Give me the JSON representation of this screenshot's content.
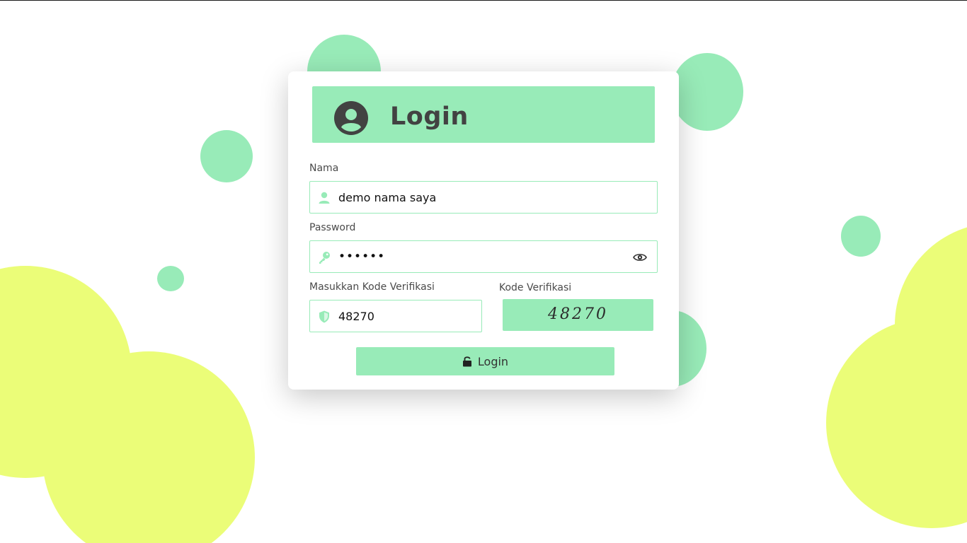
{
  "colors": {
    "accent_green": "#98ebb8",
    "accent_yellow": "#ebfd78",
    "text_dark": "#424242"
  },
  "header": {
    "title": "Login",
    "icon": "user-circle-icon"
  },
  "form": {
    "name": {
      "label": "Nama",
      "value": "demo nama saya",
      "icon": "user-icon"
    },
    "password": {
      "label": "Password",
      "value": "••••••",
      "icon": "key-icon",
      "toggle_icon": "eye-icon"
    },
    "verification_input": {
      "label": "Masukkan Kode Verifikasi",
      "value": "48270",
      "icon": "shield-icon"
    },
    "verification_code": {
      "label": "Kode Verifikasi",
      "code": "48270"
    },
    "submit": {
      "label": "Login",
      "icon": "unlock-icon"
    }
  }
}
